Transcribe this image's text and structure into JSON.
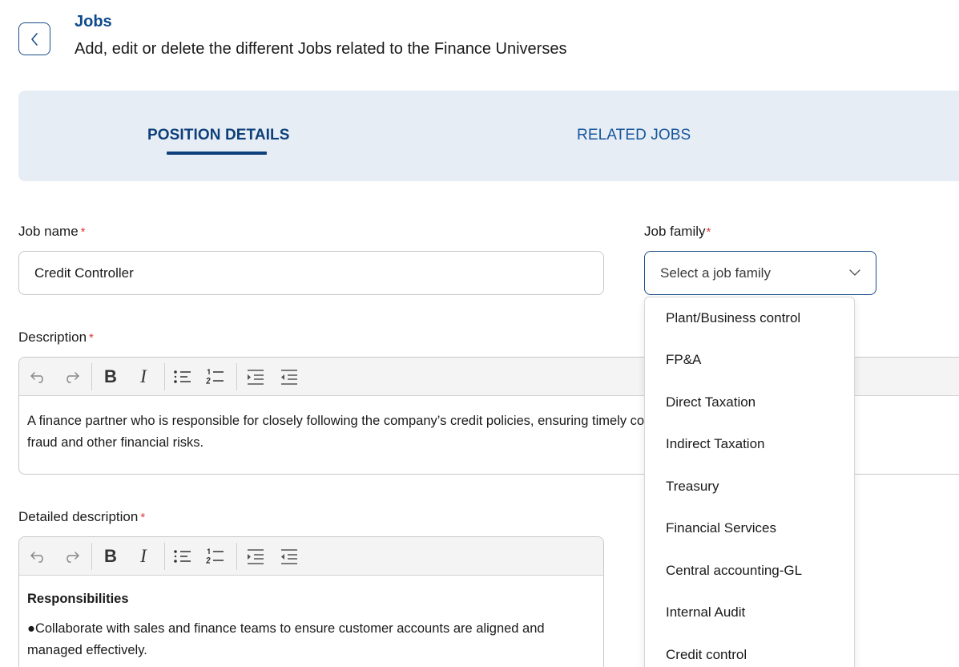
{
  "header": {
    "title": "Jobs",
    "subtitle": "Add, edit or delete the different Jobs related to the Finance Universes"
  },
  "tabs": [
    {
      "label": "POSITION DETAILS",
      "active": true
    },
    {
      "label": "RELATED JOBS",
      "active": false
    }
  ],
  "form": {
    "job_name": {
      "label": "Job name",
      "required_mark": "*",
      "value": "Credit Controller"
    },
    "job_family": {
      "label": "Job family",
      "required_mark": "*",
      "placeholder": "Select a job family"
    },
    "description": {
      "label": "Description",
      "required_mark": "*",
      "line1": "A finance partner who is responsible for closely following the company’s credit policies, ensuring timely collection and ensuring the highest l",
      "line2": "fraud and other financial risks."
    },
    "detailed_description": {
      "label": "Detailed description",
      "required_mark": "*",
      "heading": "Responsibilities",
      "bullet1_line1": "●Collaborate with sales and finance teams to ensure customer accounts are aligned and",
      "bullet1_line2": "managed effectively."
    }
  },
  "job_family_options": [
    "Plant/Business control",
    "FP&A",
    "Direct Taxation",
    "Indirect Taxation",
    "Treasury",
    "Financial Services",
    "Central accounting-GL",
    "Internal Audit",
    "Credit control"
  ],
  "colors": {
    "brand_dark": "#0d3f7a",
    "brand": "#17569b",
    "tab_bar_bg": "#e7edf5",
    "required": "#e03a3a"
  },
  "icons": [
    "chevron-left-icon",
    "chevron-down-icon",
    "undo-icon",
    "redo-icon",
    "bold-icon",
    "italic-icon",
    "bullet-list-icon",
    "numbered-list-icon",
    "indent-icon",
    "outdent-icon"
  ]
}
